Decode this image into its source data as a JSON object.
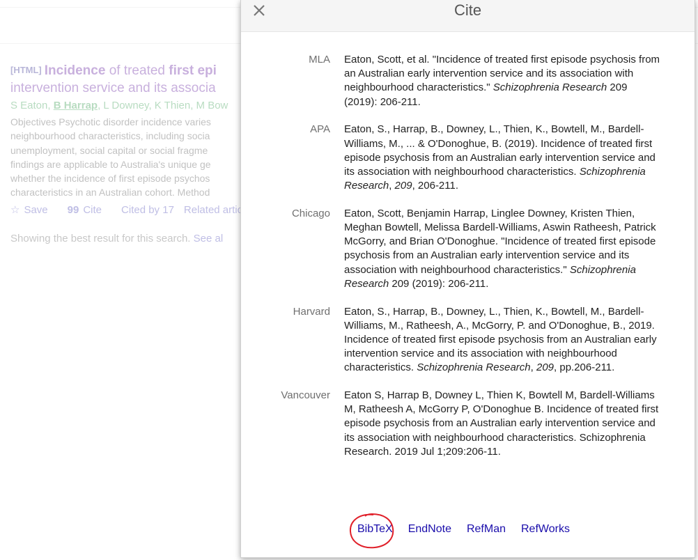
{
  "dialog": {
    "title": "Cite",
    "close_label": "×",
    "citations": [
      {
        "format": "MLA",
        "text": {
          "pre": "Eaton, Scott, et al. \"Incidence of treated first episode psychosis from an Australian early intervention service and its association with neighbourhood characteristics.\" ",
          "italic": "Schizophrenia Research",
          "post": " 209 (2019): 206-211."
        }
      },
      {
        "format": "APA",
        "text": {
          "pre": "Eaton, S., Harrap, B., Downey, L., Thien, K., Bowtell, M., Bardell-Williams, M., ... & O'Donoghue, B. (2019). Incidence of treated first episode psychosis from an Australian early intervention service and its association with neighbourhood characteristics. ",
          "italic": "Schizophrenia Research",
          "mid": ", ",
          "italic2": "209",
          "post": ", 206-211."
        }
      },
      {
        "format": "Chicago",
        "text": {
          "pre": "Eaton, Scott, Benjamin Harrap, Linglee Downey, Kristen Thien, Meghan Bowtell, Melissa Bardell-Williams, Aswin Ratheesh, Patrick McGorry, and Brian O'Donoghue. \"Incidence of treated first episode psychosis from an Australian early intervention service and its association with neighbourhood characteristics.\" ",
          "italic": "Schizophrenia Research",
          "post": " 209 (2019): 206-211."
        }
      },
      {
        "format": "Harvard",
        "text": {
          "pre": "Eaton, S., Harrap, B., Downey, L., Thien, K., Bowtell, M., Bardell-Williams, M., Ratheesh, A., McGorry, P. and O'Donoghue, B., 2019. Incidence of treated first episode psychosis from an Australian early intervention service and its association with neighbourhood characteristics. ",
          "italic": "Schizophrenia Research",
          "mid": ", ",
          "italic2": "209",
          "post": ", pp.206-211."
        }
      },
      {
        "format": "Vancouver",
        "text": {
          "pre": "Eaton S, Harrap B, Downey L, Thien K, Bowtell M, Bardell-Williams M, Ratheesh A, McGorry P, O'Donoghue B. Incidence of treated first episode psychosis from an Australian early intervention service and its association with neighbourhood characteristics. Schizophrenia Research. 2019 Jul 1;209:206-11."
        }
      }
    ],
    "exports": [
      "BibTeX",
      "EndNote",
      "RefMan",
      "RefWorks"
    ],
    "highlight_color": "#e0202a"
  },
  "result": {
    "tag": "[HTML]",
    "title_bold1": "Incidence",
    "title_mid": " of treated ",
    "title_bold2": "first epi",
    "title_line2": "intervention service and its associa",
    "authors": {
      "pre": "S Eaton, ",
      "highlight": "B Harrap",
      "post": ", L Downey, K Thien, M Bow"
    },
    "snippet": [
      "Objectives Psychotic disorder incidence varies",
      "neighbourhood characteristics, including socia",
      "unemployment, social capital or social fragme",
      "findings are applicable to Australia's unique ge",
      "whether the incidence of first episode psychos",
      "characteristics in an Australian cohort. Method"
    ],
    "actions": {
      "save": "Save",
      "cite": "Cite",
      "cited_by": "Cited by 17",
      "related": "Related artic"
    }
  },
  "best_result": {
    "text": "Showing the best result for this search. ",
    "link": "See al"
  },
  "colors": {
    "title": "#9b6fc2",
    "authors": "#7fbf8e",
    "action_link": "#8b89cf",
    "export_link": "#1a0dab"
  }
}
